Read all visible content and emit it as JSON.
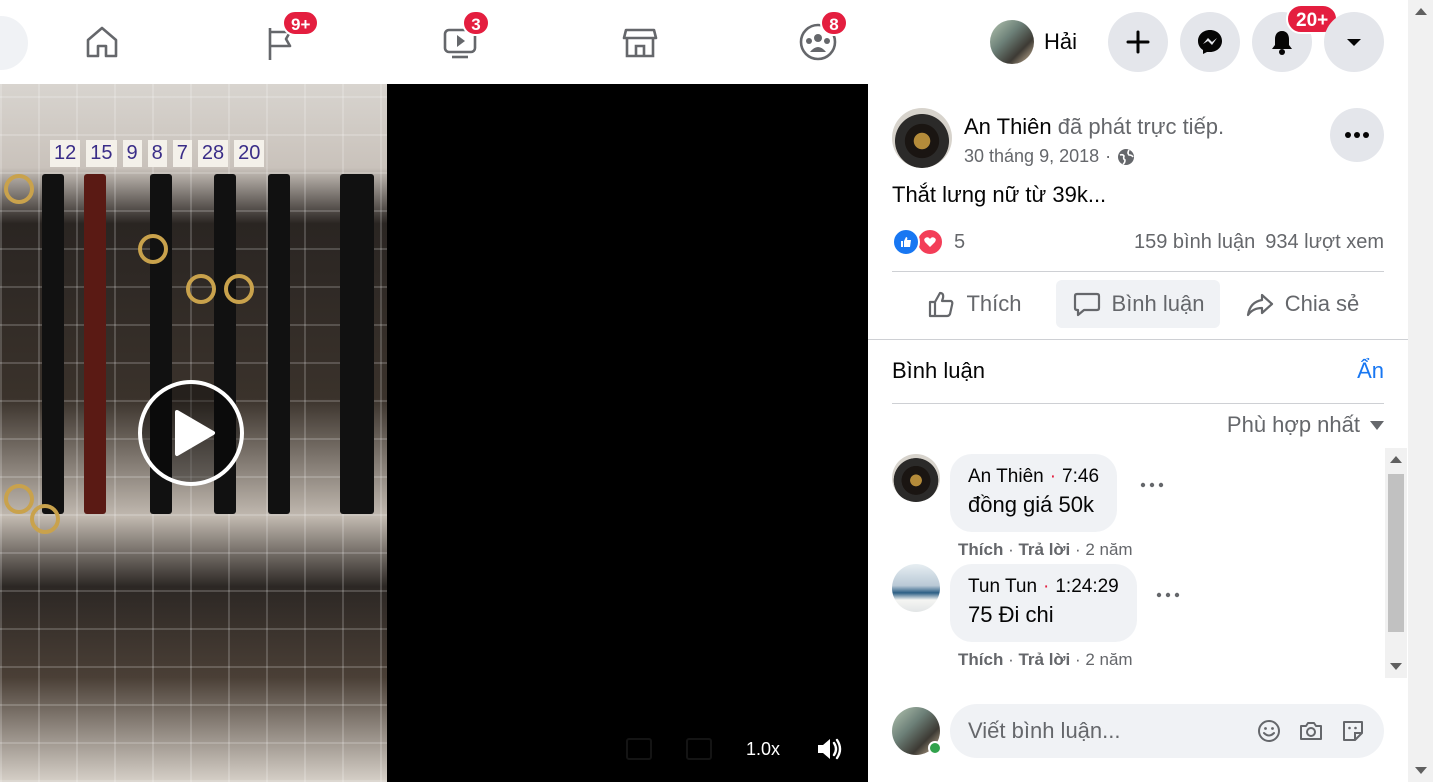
{
  "nav": {
    "tabs": [
      {
        "name": "home",
        "icon": "home-icon",
        "badge": ""
      },
      {
        "name": "pages",
        "icon": "flag-icon",
        "badge": "9+"
      },
      {
        "name": "watch",
        "icon": "video-icon",
        "badge": "3"
      },
      {
        "name": "marketplace",
        "icon": "marketplace-icon",
        "badge": ""
      },
      {
        "name": "groups",
        "icon": "groups-icon",
        "badge": "8"
      }
    ],
    "profile_name": "Hải",
    "notifications_badge": "20+"
  },
  "video": {
    "price_tags": [
      "12",
      "15",
      "9",
      "8",
      "7",
      "28",
      "20"
    ],
    "speed": "1.0x"
  },
  "post": {
    "author": "An Thiên",
    "action": "đã phát trực tiếp.",
    "date": "30 tháng 9, 2018",
    "separator": "·",
    "text": "Thắt lưng nữ từ 39k...",
    "reaction_count": "5",
    "comments_count": "159 bình luận",
    "views_count": "934 lượt xem",
    "actions": {
      "like": "Thích",
      "comment": "Bình luận",
      "share": "Chia sẻ"
    }
  },
  "comments_section": {
    "title": "Bình luận",
    "hide_label": "Ẩn",
    "sort_label": "Phù hợp nhất",
    "items": [
      {
        "author": "An Thiên",
        "dot": "·",
        "timestamp": "7:46",
        "text": "đồng giá 50k",
        "like": "Thích",
        "reply": "Trả lời",
        "age": "2 năm"
      },
      {
        "author": "Tun Tun",
        "dot": "·",
        "timestamp": "1:24:29",
        "text": "75 Đi chi",
        "like": "Thích",
        "reply": "Trả lời",
        "age": "2 năm"
      }
    ]
  },
  "composer": {
    "placeholder": "Viết bình luận..."
  },
  "colors": {
    "brand_blue": "#1877f2",
    "badge_red": "#e41e3f",
    "online_green": "#31a24c"
  }
}
